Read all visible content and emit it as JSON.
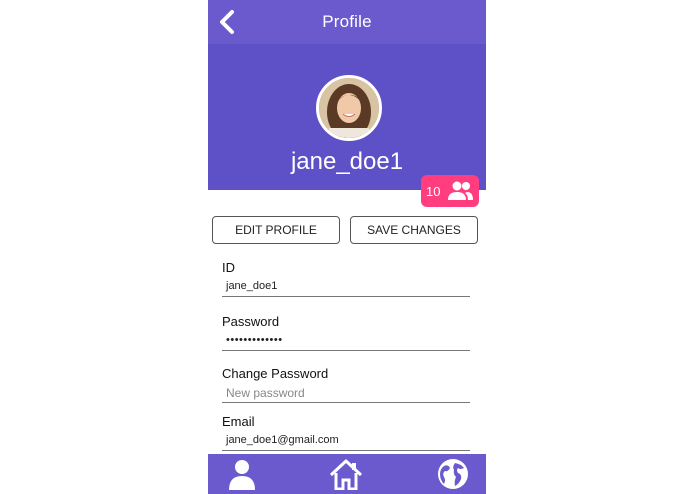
{
  "header": {
    "title": "Profile"
  },
  "profile": {
    "username": "jane_doe1",
    "friends_count": "10"
  },
  "actions": {
    "edit_label": "EDIT PROFILE",
    "save_label": "SAVE CHANGES"
  },
  "form": {
    "id": {
      "label": "ID",
      "value": "jane_doe1"
    },
    "password": {
      "label": "Password",
      "value": "•••••••••••••"
    },
    "change_password": {
      "label": "Change Password",
      "placeholder": "New password"
    },
    "email": {
      "label": "Email",
      "value": "jane_doe1@gmail.com"
    }
  },
  "nav": {
    "items": [
      "person-icon",
      "home-icon",
      "globe-icon"
    ]
  },
  "colors": {
    "primary": "#6a5acd",
    "hero": "#5e50c7",
    "badge": "#ff3d7f"
  }
}
